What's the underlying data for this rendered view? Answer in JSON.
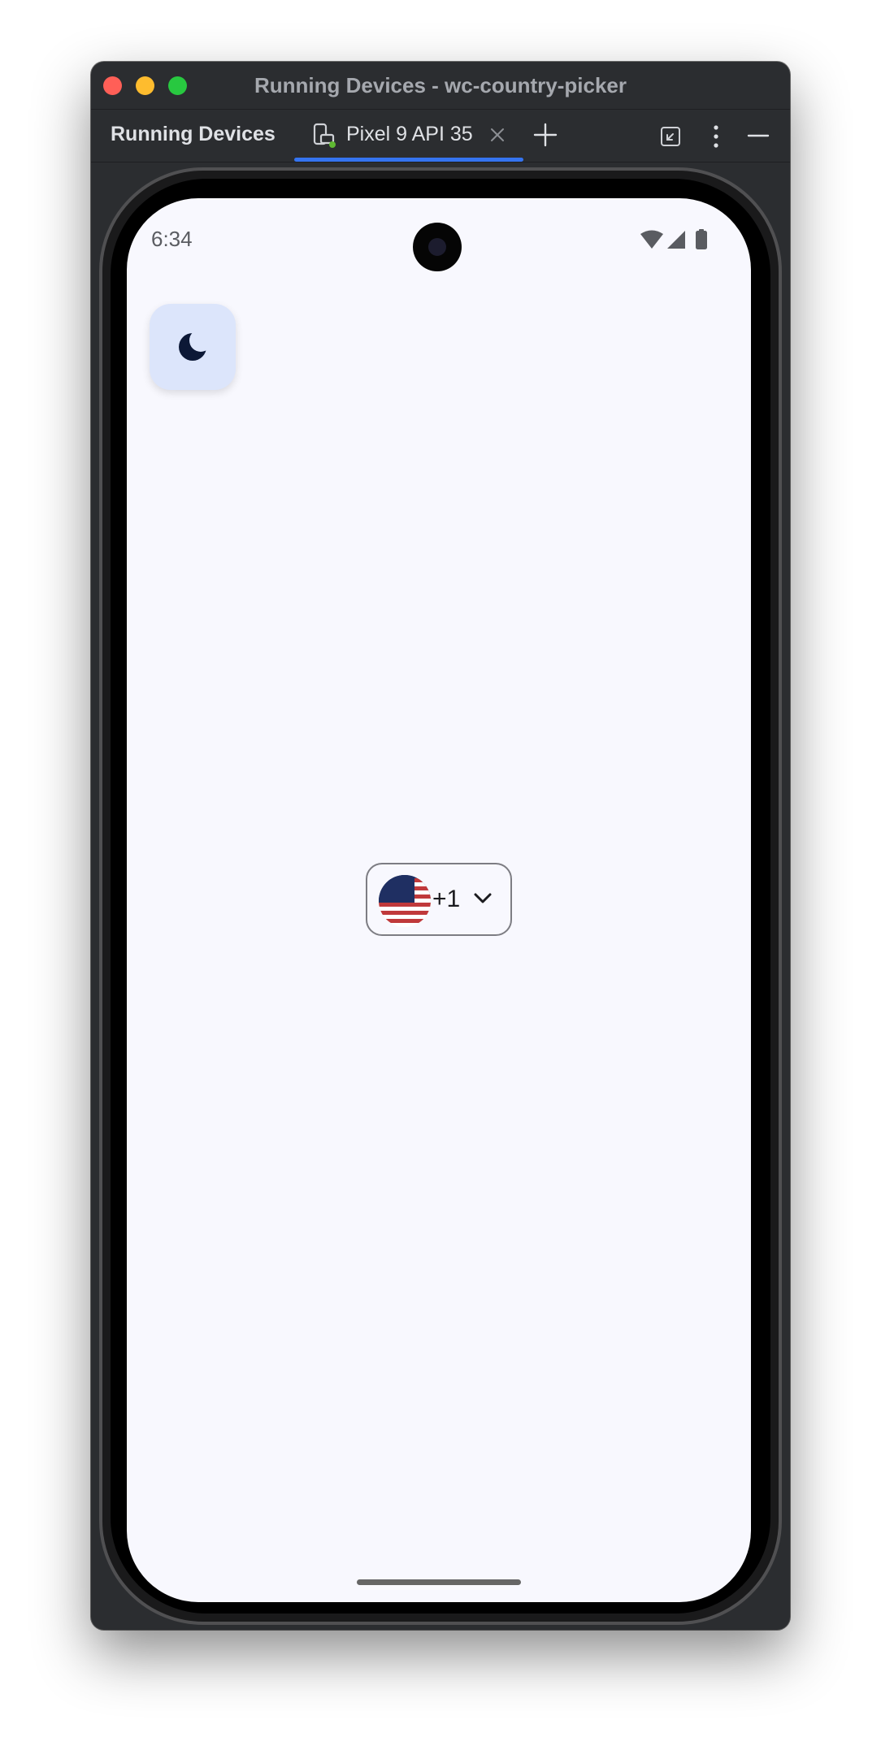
{
  "window": {
    "title": "Running Devices - wc-country-picker"
  },
  "toolbar": {
    "title": "Running Devices",
    "tab_label": "Pixel 9 API 35",
    "icons": [
      "device-mirror-icon",
      "close-icon",
      "plus-icon",
      "restore-icon",
      "more-vertical-icon",
      "minimize-icon"
    ]
  },
  "device": {
    "status_time": "6:34",
    "status_icons": [
      "wifi-icon",
      "signal-icon",
      "battery-icon"
    ],
    "theme_toggle_icon": "moon-icon",
    "country_picker": {
      "flag": "us-flag-icon",
      "dial_code": "+1",
      "dropdown_icon": "chevron-down-icon"
    }
  },
  "colors": {
    "window_bg": "#2b2d30",
    "accent": "#3574f0",
    "screen_bg": "#f8f8fe",
    "theme_button_bg": "#dce5fb"
  }
}
